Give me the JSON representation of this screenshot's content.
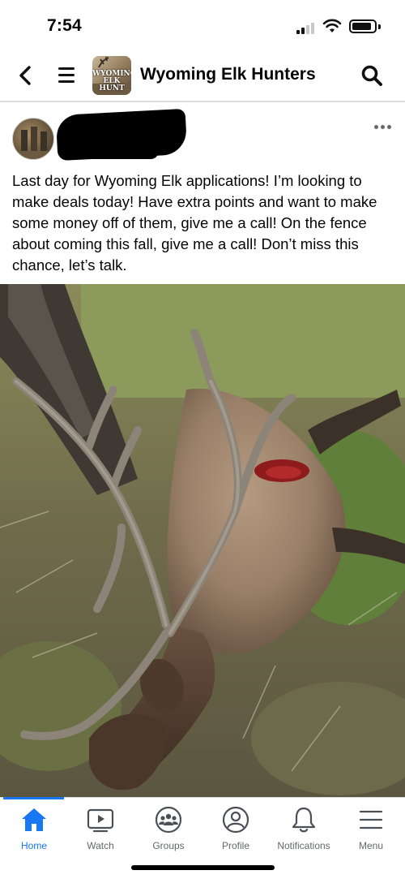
{
  "status_bar": {
    "time": "7:54"
  },
  "header": {
    "group_title": "Wyoming Elk Hunters",
    "avatar_text": "WYOMING\nELK HUNT"
  },
  "post": {
    "text": "Last day for Wyoming Elk applications! I’m looking to make deals today! Have extra points and want to make some money off of them, give me a call! On the fence about coming this fall, give me a call! Don’t miss this chance, let’s talk."
  },
  "tabs": [
    {
      "label": "Home",
      "icon": "home-icon",
      "active": true
    },
    {
      "label": "Watch",
      "icon": "watch-icon",
      "active": false
    },
    {
      "label": "Groups",
      "icon": "groups-icon",
      "active": false
    },
    {
      "label": "Profile",
      "icon": "profile-icon",
      "active": false
    },
    {
      "label": "Notifications",
      "icon": "bell-icon",
      "active": false
    },
    {
      "label": "Menu",
      "icon": "menu-icon",
      "active": false
    }
  ],
  "colors": {
    "accent": "#1877f2",
    "inactive": "#65676b"
  }
}
